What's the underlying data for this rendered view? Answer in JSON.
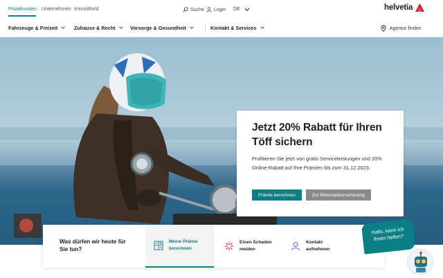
{
  "topbar": {
    "segments": [
      "Privatkunden",
      "Unternehmen",
      "ImmoWorld"
    ],
    "search_label": "Suche",
    "login_label": "Login",
    "language": "DE",
    "logo_text": "helvetia"
  },
  "nav": {
    "items": [
      "Fahrzeuge & Freizeit",
      "Zuhause & Recht",
      "Vorsorge & Gesundheit",
      "Kontakt & Services"
    ],
    "agent_label": "Agentur finden"
  },
  "hero": {
    "headline": "Jetzt 20% Rabatt für Ihren Töff sichern",
    "text": "Profitieren Sie jetzt von gratis Serviceleistungen und 20% Online-Rabatt auf Ihre Prämien bis zum 31.12.2023.",
    "primary_button": "Prämie berechnen",
    "secondary_button": "Zur Motorradversicherung"
  },
  "quick": {
    "title": "Was dürfen wir heute für Sie tun?",
    "items": [
      "Meine Prämie berechnen",
      "Einen Schaden melden",
      "Kontakt aufnehmen"
    ]
  },
  "chat": {
    "bubble": "Hallo, kann ich Ihnen helfen?"
  },
  "colors": {
    "brand": "#0b7f86",
    "logo_red": "#d50f32",
    "secondary_button": "#8a8a8a"
  }
}
